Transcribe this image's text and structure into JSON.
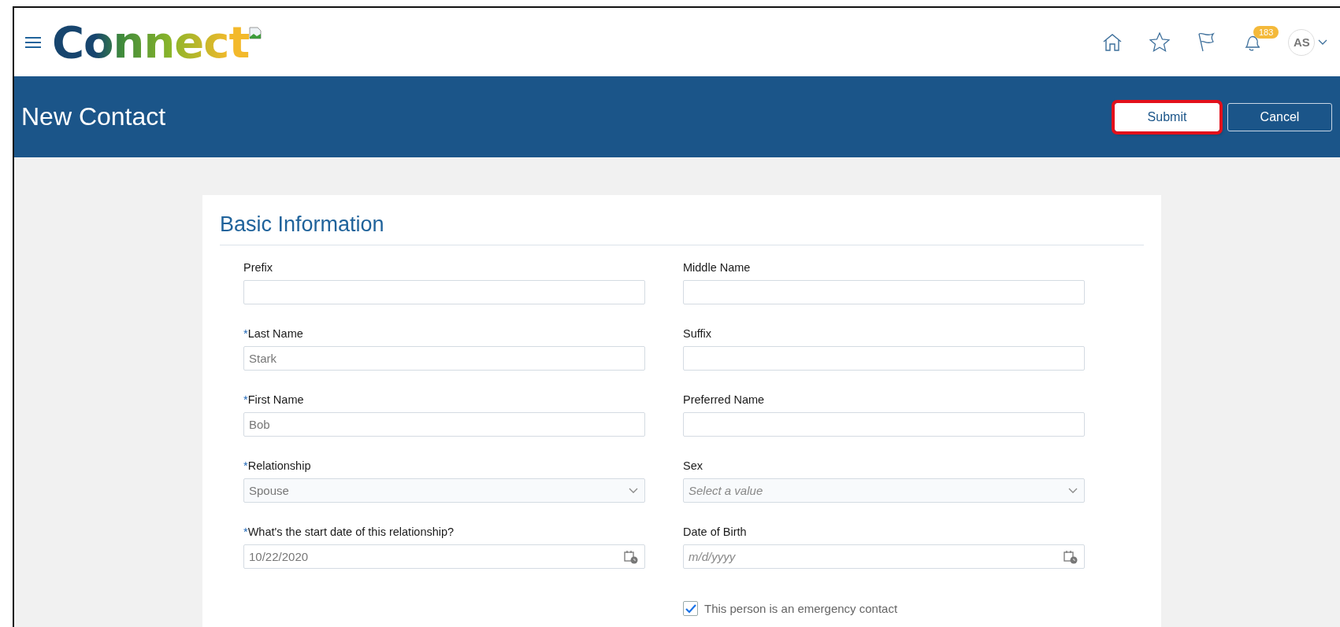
{
  "required_mark": "*",
  "header": {
    "logo": "Connect",
    "notifications_count": "183",
    "avatar": "AS"
  },
  "page": {
    "title": "New Contact",
    "buttons": [
      {
        "label": "Submit",
        "kind": "primary",
        "highlighted": true
      },
      {
        "label": "Cancel",
        "kind": "secondary",
        "highlighted": false
      }
    ]
  },
  "section": {
    "title": "Basic Information",
    "columns": [
      [
        {
          "label": "Prefix",
          "kind": "text",
          "required": false
        },
        {
          "label": "Last Name",
          "kind": "text",
          "required": true,
          "value": "Stark"
        },
        {
          "label": "First Name",
          "kind": "text",
          "required": true,
          "value": "Bob"
        },
        {
          "label": "Relationship",
          "kind": "select",
          "required": true,
          "value": "Spouse"
        },
        {
          "label": "What's the start date of this relationship?",
          "kind": "date",
          "required": true,
          "value": "10/22/2020"
        }
      ],
      [
        {
          "label": "Middle Name",
          "kind": "text",
          "required": false
        },
        {
          "label": "Suffix",
          "kind": "text",
          "required": false
        },
        {
          "label": "Preferred Name",
          "kind": "text",
          "required": false
        },
        {
          "label": "Sex",
          "kind": "select",
          "required": false,
          "placeholder": "Select a value"
        },
        {
          "label": "Date of Birth",
          "kind": "date",
          "required": false,
          "placeholder": "m/d/yyyy"
        },
        {
          "label": "This person is an emergency contact",
          "kind": "checkbox",
          "checked": true
        }
      ]
    ]
  }
}
